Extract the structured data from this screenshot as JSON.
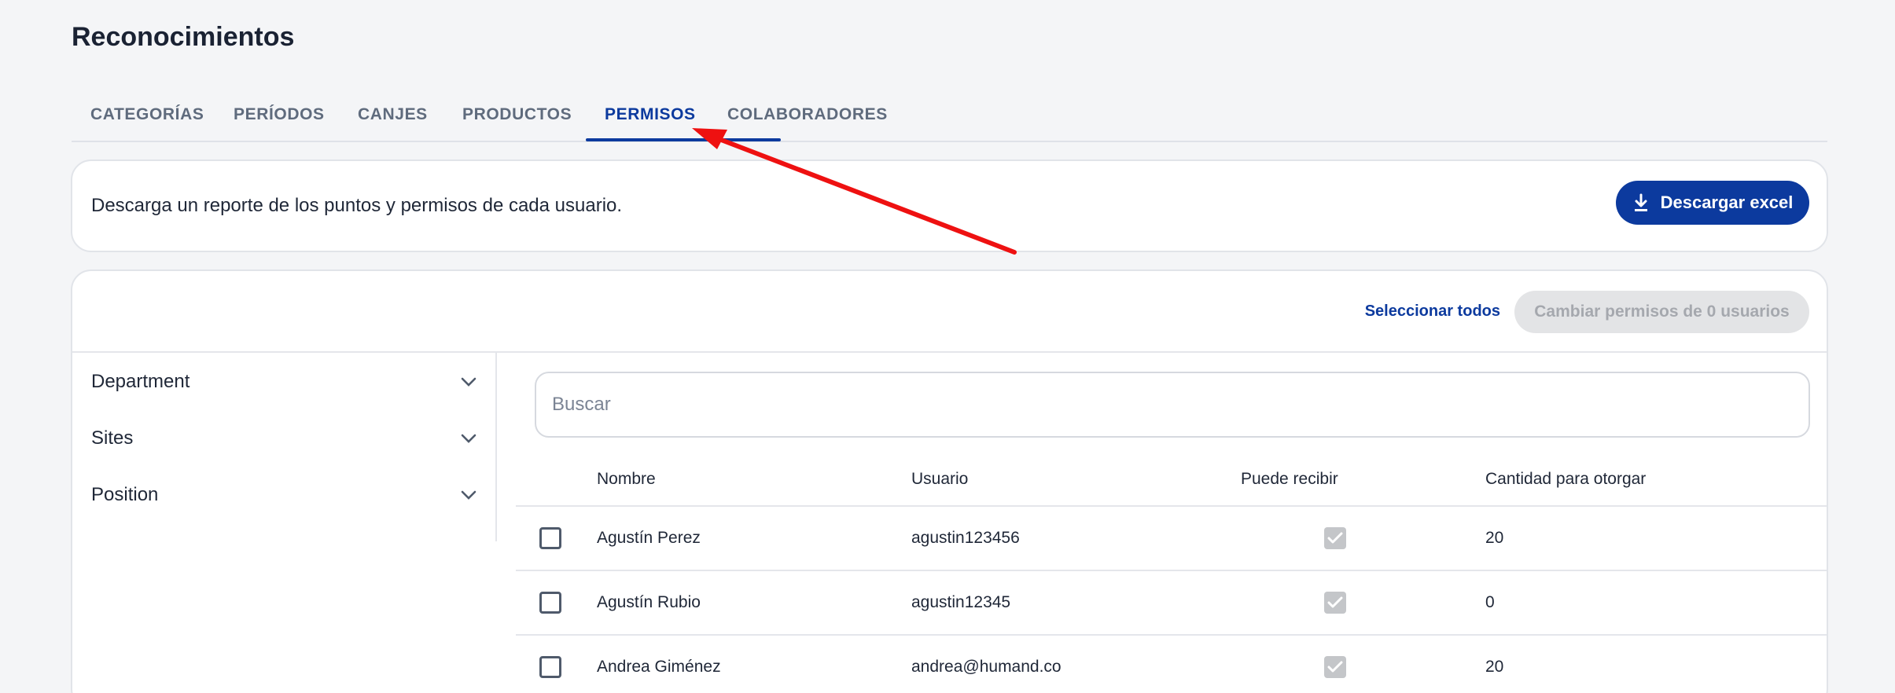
{
  "page": {
    "title": "Reconocimientos"
  },
  "tabs": [
    {
      "label": "CATEGORÍAS"
    },
    {
      "label": "PERÍODOS"
    },
    {
      "label": "CANJES"
    },
    {
      "label": "PRODUCTOS"
    },
    {
      "label": "PERMISOS",
      "active": true
    },
    {
      "label": "COLABORADORES"
    }
  ],
  "report": {
    "text": "Descarga un reporte de los puntos y permisos de cada usuario.",
    "download_label": "Descargar excel",
    "icon": "download-icon"
  },
  "toolbar": {
    "select_all": "Seleccionar todos",
    "change_permissions": "Cambiar permisos de 0 usuarios"
  },
  "filters": [
    {
      "label": "Department",
      "icon": "chevron-down-icon"
    },
    {
      "label": "Sites",
      "icon": "chevron-down-icon"
    },
    {
      "label": "Position",
      "icon": "chevron-down-icon"
    }
  ],
  "search": {
    "placeholder": "Buscar",
    "value": ""
  },
  "table": {
    "columns": [
      "Nombre",
      "Usuario",
      "Puede recibir",
      "Cantidad para otorgar"
    ],
    "rows": [
      {
        "name": "Agustín Perez",
        "user": "agustin123456",
        "can_receive": true,
        "amount": "20"
      },
      {
        "name": "Agustín Rubio",
        "user": "agustin12345",
        "can_receive": true,
        "amount": "0"
      },
      {
        "name": "Andrea Giménez",
        "user": "andrea@humand.co",
        "can_receive": true,
        "amount": "20"
      }
    ]
  },
  "colors": {
    "accent": "#0c3a9e",
    "annotation_arrow": "#ee1111",
    "disabled_bg": "#e3e4e6"
  }
}
